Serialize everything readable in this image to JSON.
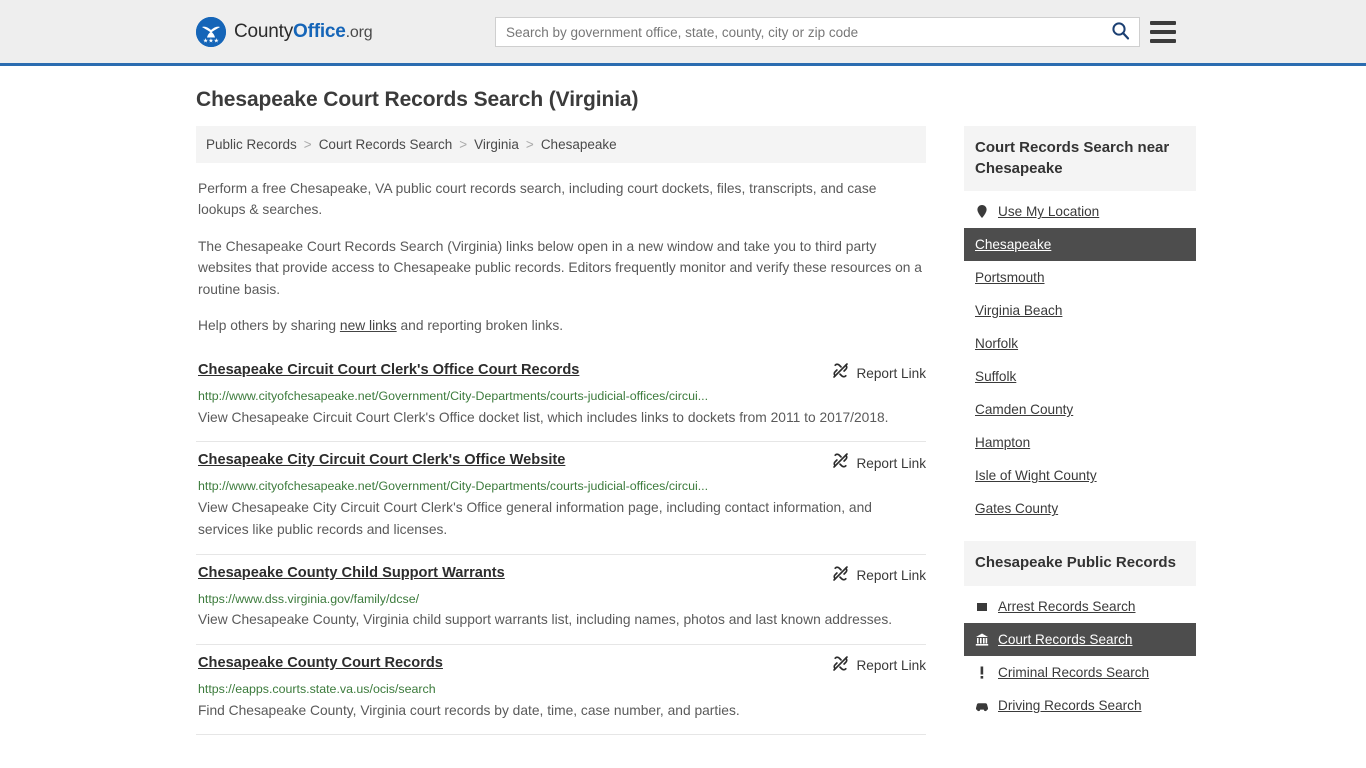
{
  "header": {
    "brand": {
      "part1": "County",
      "part2": "Office",
      "part3": ".org",
      "logo_icon": "eagle-shield-logo"
    },
    "search": {
      "placeholder": "Search by government office, state, county, city or zip code",
      "value": "",
      "icon": "search-icon"
    },
    "menu": {
      "icon": "hamburger-menu-icon"
    }
  },
  "page": {
    "title": "Chesapeake Court Records Search (Virginia)"
  },
  "breadcrumb": {
    "items": [
      {
        "label": "Public Records"
      },
      {
        "label": "Court Records Search"
      },
      {
        "label": "Virginia"
      },
      {
        "label": "Chesapeake"
      }
    ],
    "separator": ">"
  },
  "intro": {
    "p1": "Perform a free Chesapeake, VA public court records search, including court dockets, files, transcripts, and case lookups & searches.",
    "p2": "The Chesapeake Court Records Search (Virginia) links below open in a new window and take you to third party websites that provide access to Chesapeake public records. Editors frequently monitor and verify these resources on a routine basis.",
    "p3_before": "Help others by sharing ",
    "p3_link": "new links",
    "p3_after": " and reporting broken links."
  },
  "results": {
    "report_label": "Report Link",
    "report_icon": "broken-link-icon",
    "items": [
      {
        "title": "Chesapeake Circuit Court Clerk's Office Court Records",
        "url": "http://www.cityofchesapeake.net/Government/City-Departments/courts-judicial-offices/circui...",
        "description": "View Chesapeake Circuit Court Clerk's Office docket list, which includes links to dockets from 2011 to 2017/2018."
      },
      {
        "title": "Chesapeake City Circuit Court Clerk's Office Website",
        "url": "http://www.cityofchesapeake.net/Government/City-Departments/courts-judicial-offices/circui...",
        "description": "View Chesapeake City Circuit Court Clerk's Office general information page, including contact information, and services like public records and licenses."
      },
      {
        "title": "Chesapeake County Child Support Warrants",
        "url": "https://www.dss.virginia.gov/family/dcse/",
        "description": "View Chesapeake County, Virginia child support warrants list, including names, photos and last known addresses."
      },
      {
        "title": "Chesapeake County Court Records",
        "url": "https://eapps.courts.state.va.us/ocis/search",
        "description": "Find Chesapeake County, Virginia court records by date, time, case number, and parties."
      }
    ]
  },
  "sidebar": {
    "nearby": {
      "title": "Court Records Search near Chesapeake",
      "items": [
        {
          "label": "Use My Location",
          "icon": "map-pin-icon",
          "active": false
        },
        {
          "label": "Chesapeake",
          "icon": "",
          "active": true
        },
        {
          "label": "Portsmouth",
          "icon": "",
          "active": false
        },
        {
          "label": "Virginia Beach",
          "icon": "",
          "active": false
        },
        {
          "label": "Norfolk",
          "icon": "",
          "active": false
        },
        {
          "label": "Suffolk",
          "icon": "",
          "active": false
        },
        {
          "label": "Camden County",
          "icon": "",
          "active": false
        },
        {
          "label": "Hampton",
          "icon": "",
          "active": false
        },
        {
          "label": "Isle of Wight County",
          "icon": "",
          "active": false
        },
        {
          "label": "Gates County",
          "icon": "",
          "active": false
        }
      ]
    },
    "public_records": {
      "title": "Chesapeake Public Records",
      "items": [
        {
          "label": "Arrest Records Search",
          "icon": "handcuffs-icon",
          "active": false
        },
        {
          "label": "Court Records Search",
          "icon": "courthouse-icon",
          "active": true
        },
        {
          "label": "Criminal Records Search",
          "icon": "exclamation-icon",
          "active": false
        },
        {
          "label": "Driving Records Search",
          "icon": "car-icon",
          "active": false
        }
      ]
    }
  },
  "colors": {
    "brand_blue": "#1565b8",
    "header_bg": "#eeeeee",
    "header_border": "#2b6cb0",
    "panel_bg": "#f4f4f4",
    "active_bg": "#4d4d4d",
    "url_green": "#3c7b3c"
  }
}
